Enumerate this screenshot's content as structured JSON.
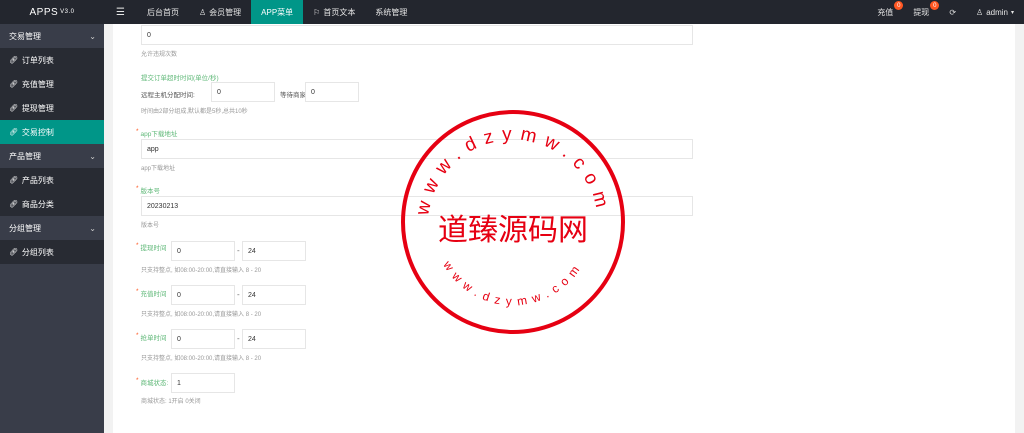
{
  "header": {
    "logo": "APPS",
    "version": "V3.0",
    "menu_icon": "hamburger-icon",
    "nav": [
      {
        "label": "后台首页",
        "icon": ""
      },
      {
        "label": "会员管理",
        "icon": "user-icon"
      },
      {
        "label": "APP菜单",
        "icon": ""
      },
      {
        "label": "首页文本",
        "icon": "flag-icon"
      },
      {
        "label": "系统管理",
        "icon": ""
      }
    ],
    "active_nav": "APP菜单",
    "recharge": {
      "label": "充值",
      "badge": "0"
    },
    "withdraw": {
      "label": "提现",
      "badge": "0"
    },
    "refresh_icon": "refresh-icon",
    "user": "admin"
  },
  "sidebar": {
    "groups": [
      {
        "label": "交易管理",
        "items": [
          "订单列表",
          "充值管理",
          "提现管理",
          "交易控制"
        ]
      },
      {
        "label": "产品管理",
        "items": [
          "产品列表",
          "商品分类"
        ]
      },
      {
        "label": "分组管理",
        "items": [
          "分组列表"
        ]
      }
    ],
    "active_item": "交易控制"
  },
  "form": {
    "top_value": "0",
    "top_hint": "允许违规次数",
    "submit_time": {
      "label": "提交订单超时时间(单位/秒)",
      "remote_label": "远程主机分配时间:",
      "remote_value": "0",
      "wait_label": "等待商家确定时间",
      "wait_value": "0",
      "hint": "时间由2部分组成,默认都是5秒,总共10秒"
    },
    "app_url": {
      "label": "app下载地址",
      "value": "app",
      "hint": "app下载地址"
    },
    "version": {
      "label": "版本号",
      "value": "20230213",
      "hint": "版本号"
    },
    "withdraw_time": {
      "label": "提现时间",
      "start": "0",
      "end": "24",
      "hint": "只支持整点, 如08:00-20:00,请直接输入 8 - 20"
    },
    "recharge_time": {
      "label": "充值时间",
      "start": "0",
      "end": "24",
      "hint": "只支持整点, 如08:00-20:00,请直接输入 8 - 20"
    },
    "grab_time": {
      "label": "抢单时间",
      "start": "0",
      "end": "24",
      "hint": "只支持整点, 如08:00-20:00,请直接输入 8 - 20"
    },
    "mall_status": {
      "label": "商城状态:",
      "value": "1",
      "hint": "商城状态: 1开启 0关闭"
    },
    "dash": "-"
  },
  "stamp": {
    "title": "道臻源码网",
    "ring_top": "www.dzymw.com",
    "ring_bottom": "www.dzymw.com",
    "color": "#e60012"
  }
}
